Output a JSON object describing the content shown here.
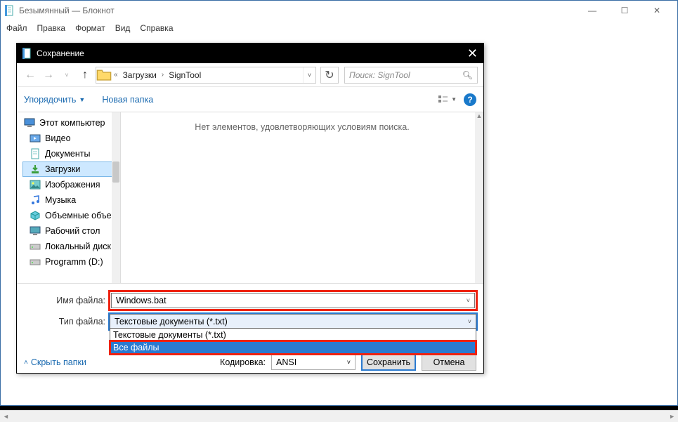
{
  "app": {
    "title": "Безымянный — Блокнот",
    "menus": [
      "Файл",
      "Правка",
      "Формат",
      "Вид",
      "Справка"
    ]
  },
  "dialog": {
    "title": "Сохранение",
    "breadcrumb": {
      "sep1": "«",
      "part1": "Загрузки",
      "part2": "SignTool"
    },
    "search_placeholder": "Поиск: SignTool",
    "toolbar": {
      "organize": "Упорядочить",
      "new_folder": "Новая папка"
    },
    "tree": {
      "root": "Этот компьютер",
      "items": [
        "Видео",
        "Документы",
        "Загрузки",
        "Изображения",
        "Музыка",
        "Объемные объекты",
        "Рабочий стол",
        "Локальный диск",
        "Programm (D:)"
      ],
      "selected_index": 2
    },
    "empty_text": "Нет элементов, удовлетворяющих условиям поиска.",
    "labels": {
      "filename": "Имя файла:",
      "filetype": "Тип файла:",
      "encoding": "Кодировка:",
      "hide": "Скрыть папки"
    },
    "filename_value": "Windows.bat",
    "filetype_value": "Текстовые документы (*.txt)",
    "filetype_options": [
      "Текстовые документы (*.txt)",
      "Все файлы"
    ],
    "filetype_dropdown_selected": 1,
    "encoding_value": "ANSI",
    "buttons": {
      "save": "Сохранить",
      "cancel": "Отмена"
    }
  }
}
